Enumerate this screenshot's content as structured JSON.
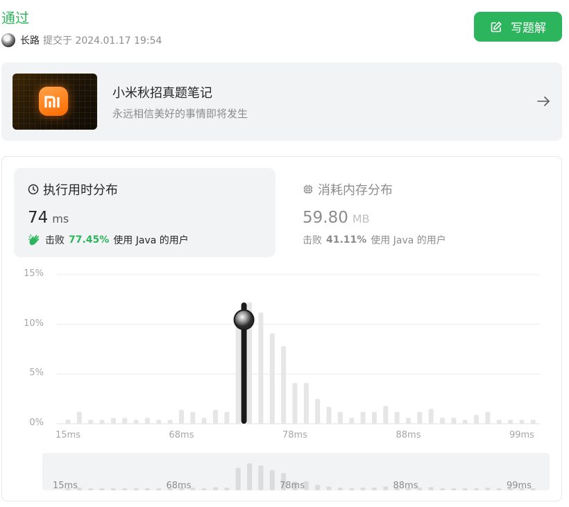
{
  "header": {
    "status": "通过",
    "user_name": "长路",
    "submitted_text": "提交于 2024.01.17 19:54",
    "write_solution_label": "写题解"
  },
  "banner": {
    "title": "小米秋招真题笔记",
    "subtitle": "永远相信美好的事情即将发生",
    "logo_text": "mi"
  },
  "runtime": {
    "title": "执行用时分布",
    "value": "74",
    "unit": "ms",
    "beat_prefix": "击败",
    "beat_percent": "77.45%",
    "beat_suffix": "使用 Java 的用户"
  },
  "memory": {
    "title": "消耗内存分布",
    "value": "59.80",
    "unit": "MB",
    "beat_prefix": "击败",
    "beat_percent": "41.11%",
    "beat_suffix": "使用 Java 的用户"
  },
  "colors": {
    "accent_green": "#2db55d",
    "bar_gray": "#e6e6e6",
    "selected_bar": "#1a1a1a",
    "text_muted": "#8c8c8c"
  },
  "chart_data": {
    "type": "bar",
    "title": "",
    "xlabel": "",
    "ylabel": "",
    "ylim": [
      0,
      15
    ],
    "y_ticks": [
      "0%",
      "5%",
      "10%",
      "15%"
    ],
    "x_ticks": [
      "15ms",
      "68ms",
      "78ms",
      "88ms",
      "99ms"
    ],
    "x_tick_indices": [
      0,
      10,
      20,
      30,
      40
    ],
    "selected_index": 16,
    "selected_label": "74ms",
    "values": [
      0.4,
      1.2,
      0.4,
      0.4,
      0.6,
      0.6,
      0.4,
      0.6,
      0.4,
      0.4,
      1.4,
      1.2,
      0.6,
      1.4,
      1.2,
      10.2,
      12.2,
      11.2,
      9.1,
      7.8,
      4.1,
      4.1,
      2.5,
      1.7,
      1.2,
      0.6,
      1.2,
      1.2,
      1.8,
      1.2,
      0.6,
      1.2,
      1.5,
      0.6,
      0.6,
      0.4,
      0.9,
      1.2,
      0.4,
      0.4,
      0.4,
      0.4
    ]
  },
  "mini_chart": {
    "labels": [
      "15ms",
      "68ms",
      "78ms",
      "88ms",
      "99ms"
    ]
  }
}
